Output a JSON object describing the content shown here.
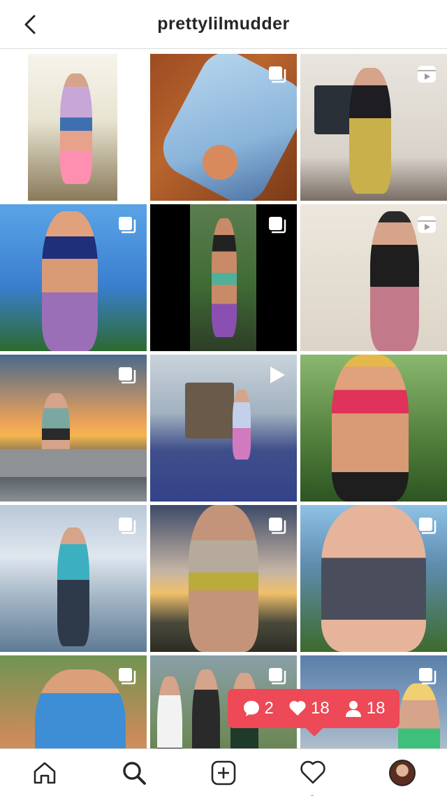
{
  "header": {
    "title": "prettylilmudder",
    "back_icon": "chevron-left-icon"
  },
  "grid": {
    "posts": [
      {
        "badge": "none"
      },
      {
        "badge": "carousel-icon"
      },
      {
        "badge": "reel-icon"
      },
      {
        "badge": "carousel-icon"
      },
      {
        "badge": "carousel-icon"
      },
      {
        "badge": "reel-icon"
      },
      {
        "badge": "carousel-icon"
      },
      {
        "badge": "video-icon"
      },
      {
        "badge": "none"
      },
      {
        "badge": "carousel-icon"
      },
      {
        "badge": "carousel-icon"
      },
      {
        "badge": "carousel-icon"
      },
      {
        "badge": "carousel-icon"
      },
      {
        "badge": "carousel-icon"
      },
      {
        "badge": "carousel-icon"
      }
    ]
  },
  "activity_bubble": {
    "comments": "2",
    "likes": "18",
    "followers": "18",
    "color": "#ed4956"
  },
  "tabbar": {
    "items": [
      "home-icon",
      "search-icon",
      "new-post-icon",
      "activity-heart-icon",
      "profile-avatar"
    ],
    "notification_dot_color": "#ed4956"
  }
}
